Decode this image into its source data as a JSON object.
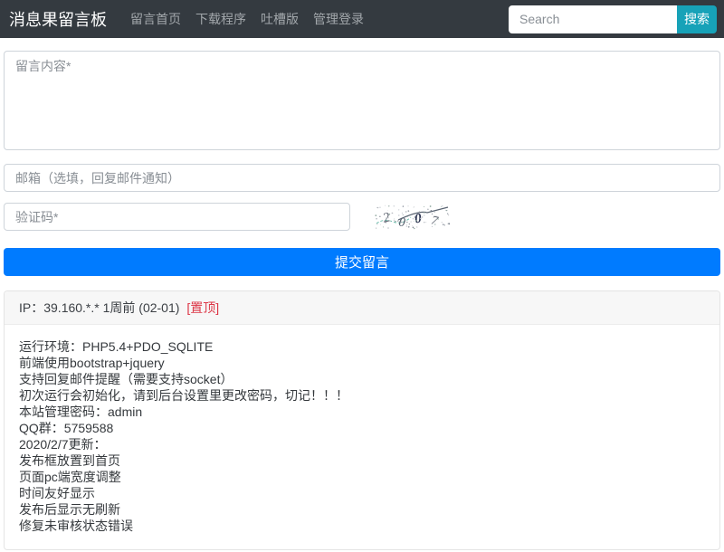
{
  "navbar": {
    "brand": "消息果留言板",
    "items": [
      {
        "label": "留言首页"
      },
      {
        "label": "下载程序"
      },
      {
        "label": "吐槽版"
      },
      {
        "label": "管理登录"
      }
    ],
    "search": {
      "placeholder": "Search",
      "button_label": "搜索"
    }
  },
  "form": {
    "content_placeholder": "留言内容*",
    "email_placeholder": "邮箱（选填，回复邮件通知）",
    "captcha_placeholder": "验证码*",
    "captcha_digits": [
      "2",
      "0",
      "0",
      "7"
    ],
    "submit_label": "提交留言"
  },
  "message": {
    "header_text": "IP：39.160.*.* 1周前 (02-01)",
    "pinned_label": "[置顶]",
    "body_lines": [
      "运行环境：PHP5.4+PDO_SQLITE",
      "前端使用bootstrap+jquery",
      "支持回复邮件提醒（需要支持socket）",
      "初次运行会初始化，请到后台设置里更改密码，切记！！！",
      "本站管理密码：admin",
      "QQ群：5759588",
      "2020/2/7更新：",
      "发布框放置到首页",
      "页面pc端宽度调整",
      "时间友好显示",
      "发布后显示无刷新",
      "修复未审核状态错误"
    ]
  },
  "colors": {
    "navbar_bg": "#343a40",
    "search_button": "#17a2b8",
    "submit_button": "#007bff",
    "pinned_red": "#dc3545"
  }
}
